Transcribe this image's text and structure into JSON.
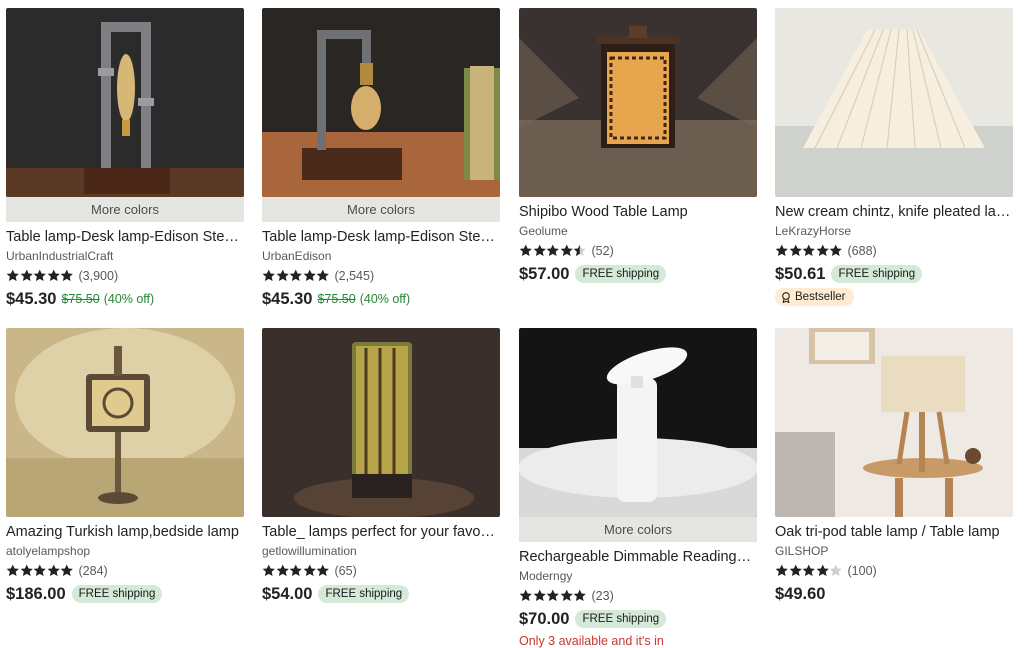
{
  "listings": [
    {
      "title": "Table lamp-Desk lamp-Edison Steampunk lamp",
      "shop": "UrbanIndustrialCraft",
      "rating": 5,
      "reviews": "(3,900)",
      "price": "$45.30",
      "original_price": "$75.50",
      "discount": "(40% off)",
      "more_colors": "More colors",
      "image": "industrial-pipe-lamp-edison-bulb"
    },
    {
      "title": "Table lamp-Desk lamp-Edison Steampunk lamp",
      "shop": "UrbanEdison",
      "rating": 5,
      "reviews": "(2,545)",
      "price": "$45.30",
      "original_price": "$75.50",
      "discount": "(40% off)",
      "more_colors": "More colors",
      "image": "pipe-lamp-with-books"
    },
    {
      "title": "Shipibo Wood Table Lamp",
      "shop": "Geolume",
      "rating": 4.5,
      "reviews": "(52)",
      "price": "$57.00",
      "shipping": "FREE shipping",
      "image": "carved-wood-lantern"
    },
    {
      "title": "New cream chintz, knife pleated lampshade",
      "shop": "LeKrazyHorse",
      "rating": 5,
      "reviews": "(688)",
      "price": "$50.61",
      "shipping": "FREE shipping",
      "badge": "Bestseller",
      "image": "pleated-cream-lampshade"
    },
    {
      "title": "Amazing Turkish lamp,bedside lamp",
      "shop": "atolyelampshop",
      "rating": 5,
      "reviews": "(284)",
      "price": "$186.00",
      "shipping": "FREE shipping",
      "image": "turkish-mosaic-lamp"
    },
    {
      "title": "Table_ lamps perfect for your favorite room",
      "shop": "getlowillumination",
      "rating": 5,
      "reviews": "(65)",
      "price": "$54.00",
      "shipping": "FREE shipping",
      "image": "forest-print-cylinder-lamp"
    },
    {
      "title": "Rechargeable Dimmable Reading Lamp",
      "shop": "Moderngy",
      "rating": 5,
      "reviews": "(23)",
      "price": "$70.00",
      "shipping": "FREE shipping",
      "more_colors": "More colors",
      "stock_note": "Only 3 available and it's in",
      "image": "white-cordless-lamp"
    },
    {
      "title": "Oak tri-pod table lamp / Table lamp",
      "shop": "GILSHOP",
      "rating": 4,
      "reviews": "(100)",
      "price": "$49.60",
      "image": "oak-tripod-lamp"
    }
  ],
  "colors": {
    "star": "#222222",
    "sale_green": "#258635",
    "shipping_bg": "#d4e9d7",
    "bestseller_bg": "#fdebd2",
    "stock_red": "#c7372f",
    "more_colors_bg": "#e3e6e1"
  }
}
